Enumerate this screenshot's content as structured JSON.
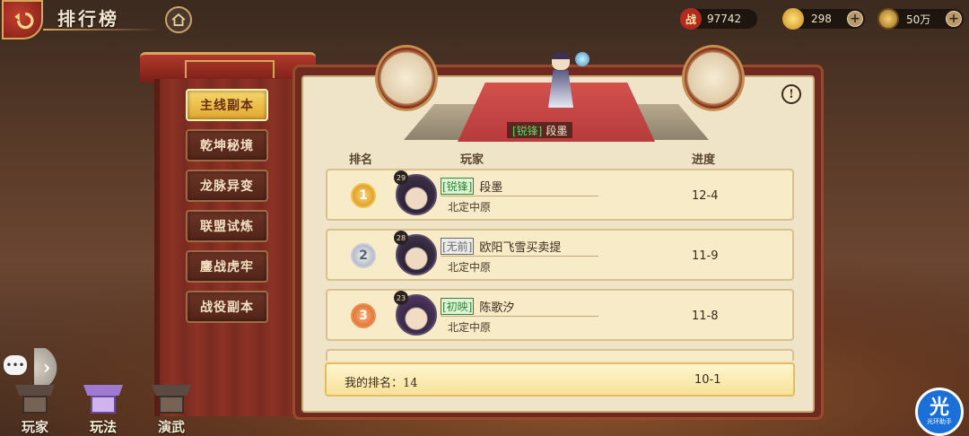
{
  "header": {
    "title": "排行榜"
  },
  "currencies": [
    {
      "icon": "battle-power-icon",
      "icon_text": "战",
      "value": "97742",
      "has_plus": false
    },
    {
      "icon": "gold-ingot-icon",
      "value": "298",
      "has_plus": true
    },
    {
      "icon": "copper-coin-icon",
      "value": "50万",
      "has_plus": true
    }
  ],
  "menu": {
    "items": [
      {
        "label": "主线副本",
        "active": true
      },
      {
        "label": "乾坤秘境",
        "active": false
      },
      {
        "label": "龙脉异变",
        "active": false
      },
      {
        "label": "联盟试炼",
        "active": false
      },
      {
        "label": "鏖战虎牢",
        "active": false
      },
      {
        "label": "战役副本",
        "active": false
      }
    ]
  },
  "stage": {
    "tag": "[锐锋]",
    "name": "段墨"
  },
  "table": {
    "headers": {
      "rank": "排名",
      "player": "玩家",
      "progress": "进度"
    },
    "rows": [
      {
        "rank": "1",
        "level": "29",
        "tag": "[锐锋]",
        "tag_color": "green",
        "name": "段墨",
        "server": "北定中原",
        "progress": "12-4"
      },
      {
        "rank": "2",
        "level": "28",
        "tag": "[无前]",
        "tag_color": "gray",
        "name": "欧阳飞雪买卖提",
        "server": "北定中原",
        "progress": "11-9"
      },
      {
        "rank": "3",
        "level": "23",
        "tag": "[初映]",
        "tag_color": "green",
        "name": "陈歌汐",
        "server": "北定中原",
        "progress": "11-8"
      }
    ]
  },
  "my_rank": {
    "label": "我的排名：",
    "rank": "14",
    "progress": "10-1"
  },
  "bottom_nav": [
    {
      "label": "玩家",
      "active": false
    },
    {
      "label": "玩法",
      "active": true
    },
    {
      "label": "演武",
      "active": false
    }
  ],
  "helper": {
    "glyph": "光",
    "text": "光环助手"
  },
  "colors": {
    "accent_gold": "#e0a830",
    "frame_red": "#7a2a20",
    "panel_bg": "#efe4c8"
  }
}
